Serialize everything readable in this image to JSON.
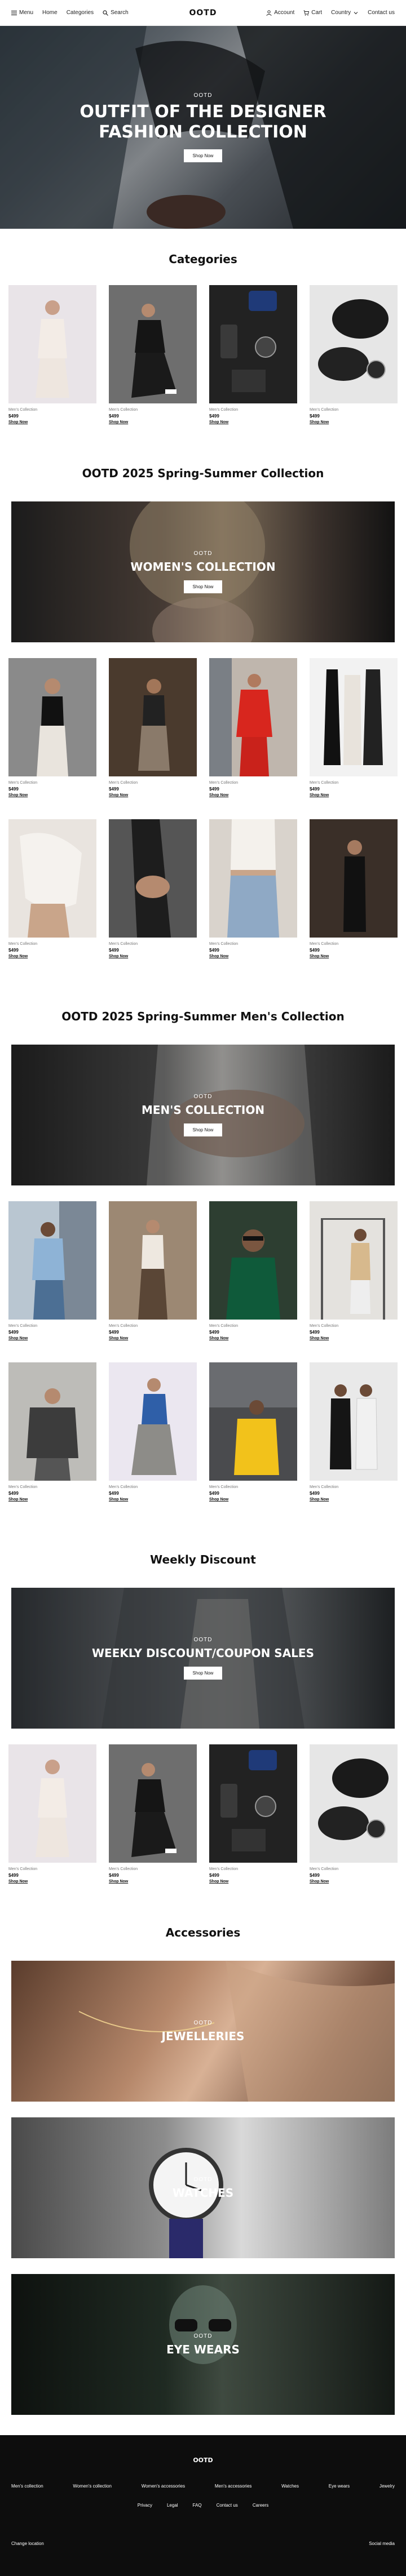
{
  "nav": {
    "menu": "Menu",
    "home": "Home",
    "categories": "Categories",
    "search": "Search",
    "brand": "OOTD",
    "account": "Account",
    "cart": "Cart",
    "country": "Country",
    "contact": "Contact us"
  },
  "hero": {
    "kicker": "OOTD",
    "title": "OUTFIT OF THE DESIGNER FASHION COLLECTION",
    "button": "Shop Now"
  },
  "sections": {
    "categories": "Categories",
    "spring_summer": "OOTD 2025 Spring-Summer Collection",
    "mens": "OOTD 2025 Spring-Summer Men's Collection",
    "weekly": "Weekly Discount",
    "accessories": "Accessories"
  },
  "banners": {
    "women": {
      "kicker": "OOTD",
      "title": "WOMEN'S COLLECTION",
      "button": "Shop Now"
    },
    "men": {
      "kicker": "OOTD",
      "title": "MEN'S COLLECTION",
      "button": "Shop Now"
    },
    "weekly": {
      "kicker": "OOTD",
      "title": "WEEKLY DISCOUNT/COUPON SALES",
      "button": "Shop Now"
    },
    "jewelleries": {
      "kicker": "OOTD",
      "title": "JEWELLERIES"
    },
    "watches": {
      "kicker": "OOTD",
      "title": "WATCHES"
    },
    "eyewears": {
      "kicker": "OOTD",
      "title": "EYE WEARS"
    }
  },
  "products": {
    "categories": [
      {
        "category": "Men's Collection",
        "price": "$499",
        "cta": "Shop Now"
      },
      {
        "category": "Men's Collection",
        "price": "$499",
        "cta": "Shop Now"
      },
      {
        "category": "Men's Collection",
        "price": "$499",
        "cta": "Shop Now"
      },
      {
        "category": "Men's Collection",
        "price": "$499",
        "cta": "Shop Now"
      }
    ],
    "women_row1": [
      {
        "category": "Men's Collection",
        "price": "$499",
        "cta": "Shop Now"
      },
      {
        "category": "Men's Collection",
        "price": "$499",
        "cta": "Shop Now"
      },
      {
        "category": "Men's Collection",
        "price": "$499",
        "cta": "Shop Now"
      },
      {
        "category": "Men's Collection",
        "price": "$499",
        "cta": "Shop Now"
      }
    ],
    "women_row2": [
      {
        "category": "Men's Collection",
        "price": "$499",
        "cta": "Shop Now"
      },
      {
        "category": "Men's Collection",
        "price": "$499",
        "cta": "Shop Now"
      },
      {
        "category": "Men's Collection",
        "price": "$499",
        "cta": "Shop Now"
      },
      {
        "category": "Men's Collection",
        "price": "$499",
        "cta": "Shop Now"
      }
    ],
    "men_row1": [
      {
        "category": "Men's Collection",
        "price": "$499",
        "cta": "Shop Now"
      },
      {
        "category": "Men's Collection",
        "price": "$499",
        "cta": "Shop Now"
      },
      {
        "category": "Men's Collection",
        "price": "$499",
        "cta": "Shop Now"
      },
      {
        "category": "Men's Collection",
        "price": "$499",
        "cta": "Shop Now"
      }
    ],
    "men_row2": [
      {
        "category": "Men's Collection",
        "price": "$499",
        "cta": "Shop Now"
      },
      {
        "category": "Men's Collection",
        "price": "$499",
        "cta": "Shop Now"
      },
      {
        "category": "Men's Collection",
        "price": "$499",
        "cta": "Shop Now"
      },
      {
        "category": "Men's Collection",
        "price": "$499",
        "cta": "Shop Now"
      }
    ],
    "weekly": [
      {
        "category": "Men's Collection",
        "price": "$499",
        "cta": "Shop Now"
      },
      {
        "category": "Men's Collection",
        "price": "$499",
        "cta": "Shop Now"
      },
      {
        "category": "Men's Collection",
        "price": "$499",
        "cta": "Shop Now"
      },
      {
        "category": "Men's Collection",
        "price": "$499",
        "cta": "Shop Now"
      }
    ]
  },
  "footer": {
    "brand": "OOTD",
    "links": [
      "Men's collection",
      "Women's collection",
      "Women's accessories",
      "Men's accessories",
      "Watches",
      "Eye wears",
      "Jewelry"
    ],
    "links2": [
      "Privacy",
      "Legal",
      "FAQ",
      "Contact us",
      "Careers"
    ],
    "change_location": "Change location",
    "social": "Social media"
  },
  "colors": {
    "footer_bg": "#0d0d0d",
    "button_bg": "#ffffff"
  }
}
